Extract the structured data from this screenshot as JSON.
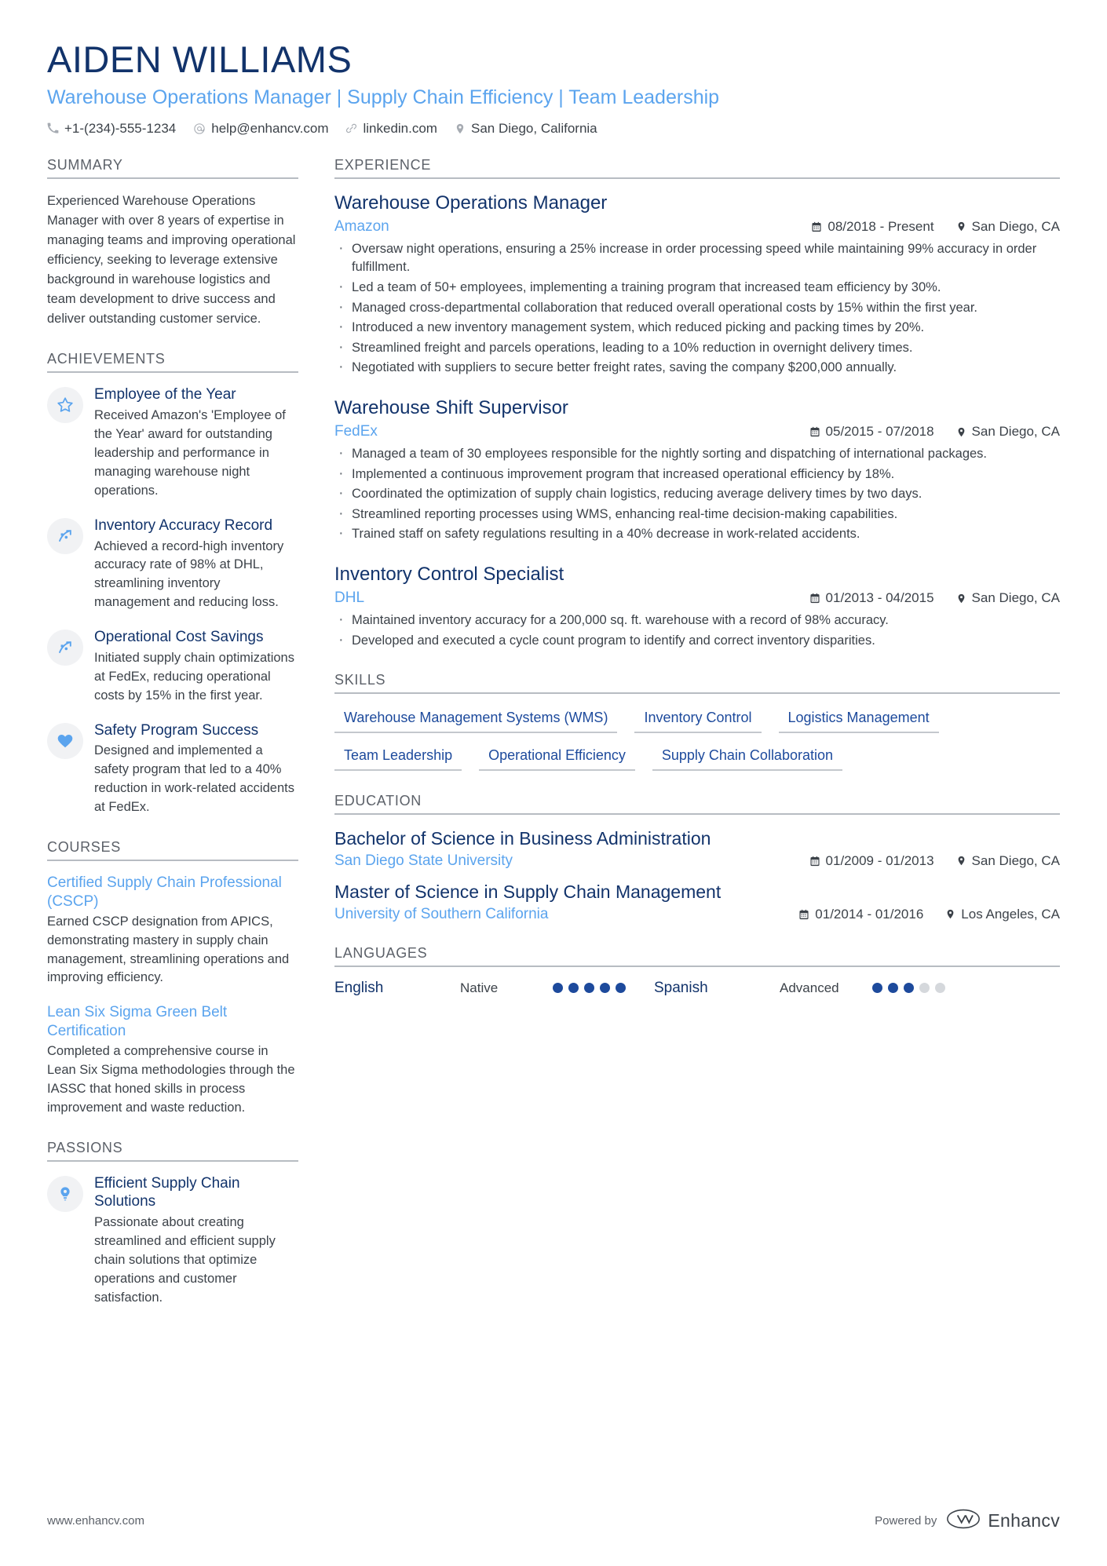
{
  "header": {
    "name": "AIDEN WILLIAMS",
    "headline": "Warehouse Operations Manager | Supply Chain Efficiency | Team Leadership",
    "contacts": [
      {
        "icon": "phone-icon",
        "text": "+1-(234)-555-1234"
      },
      {
        "icon": "email-icon",
        "text": "help@enhancv.com"
      },
      {
        "icon": "link-icon",
        "text": "linkedin.com"
      },
      {
        "icon": "location-icon",
        "text": "San Diego, California"
      }
    ]
  },
  "sections": {
    "summary_heading": "SUMMARY",
    "achievements_heading": "ACHIEVEMENTS",
    "courses_heading": "COURSES",
    "passions_heading": "PASSIONS",
    "experience_heading": "EXPERIENCE",
    "skills_heading": "SKILLS",
    "education_heading": "EDUCATION",
    "languages_heading": "LANGUAGES"
  },
  "summary": {
    "text": "Experienced Warehouse Operations Manager with over 8 years of expertise in managing teams and improving operational efficiency, seeking to leverage extensive background in warehouse logistics and team development to drive success and deliver outstanding customer service."
  },
  "achievements": [
    {
      "icon": "star-icon",
      "title": "Employee of the Year",
      "description": "Received Amazon's 'Employee of the Year' award for outstanding leadership and performance in managing warehouse night operations."
    },
    {
      "icon": "growth-arrow-icon",
      "title": "Inventory Accuracy Record",
      "description": "Achieved a record-high inventory accuracy rate of 98% at DHL, streamlining inventory management and reducing loss."
    },
    {
      "icon": "growth-arrow-icon",
      "title": "Operational Cost Savings",
      "description": "Initiated supply chain optimizations at FedEx, reducing operational costs by 15% in the first year."
    },
    {
      "icon": "heart-icon",
      "title": "Safety Program Success",
      "description": "Designed and implemented a safety program that led to a 40% reduction in work-related accidents at FedEx."
    }
  ],
  "courses": [
    {
      "title": "Certified Supply Chain Professional (CSCP)",
      "description": "Earned CSCP designation from APICS, demonstrating mastery in supply chain management, streamlining operations and improving efficiency."
    },
    {
      "title": "Lean Six Sigma Green Belt Certification",
      "description": "Completed a comprehensive course in Lean Six Sigma methodologies through the IASSC that honed skills in process improvement and waste reduction."
    }
  ],
  "passions": [
    {
      "icon": "lightbulb-icon",
      "title": "Efficient Supply Chain Solutions",
      "description": "Passionate about creating streamlined and efficient supply chain solutions that optimize operations and customer satisfaction."
    }
  ],
  "experience": [
    {
      "title": "Warehouse Operations Manager",
      "company": "Amazon",
      "dates": "08/2018 - Present",
      "location": "San Diego, CA",
      "bullets": [
        "Oversaw night operations, ensuring a 25% increase in order processing speed while maintaining 99% accuracy in order fulfillment.",
        "Led a team of 50+ employees, implementing a training program that increased team efficiency by 30%.",
        "Managed cross-departmental collaboration that reduced overall operational costs by 15% within the first year.",
        "Introduced a new inventory management system, which reduced picking and packing times by 20%.",
        "Streamlined freight and parcels operations, leading to a 10% reduction in overnight delivery times.",
        "Negotiated with suppliers to secure better freight rates, saving the company $200,000 annually."
      ]
    },
    {
      "title": "Warehouse Shift Supervisor",
      "company": "FedEx",
      "dates": "05/2015 - 07/2018",
      "location": "San Diego, CA",
      "bullets": [
        "Managed a team of 30 employees responsible for the nightly sorting and dispatching of international packages.",
        "Implemented a continuous improvement program that increased operational efficiency by 18%.",
        "Coordinated the optimization of supply chain logistics, reducing average delivery times by two days.",
        "Streamlined reporting processes using WMS, enhancing real-time decision-making capabilities.",
        "Trained staff on safety regulations resulting in a 40% decrease in work-related accidents."
      ]
    },
    {
      "title": "Inventory Control Specialist",
      "company": "DHL",
      "dates": "01/2013 - 04/2015",
      "location": "San Diego, CA",
      "bullets": [
        "Maintained inventory accuracy for a 200,000 sq. ft. warehouse with a record of 98% accuracy.",
        "Developed and executed a cycle count program to identify and correct inventory disparities."
      ]
    }
  ],
  "skills": [
    "Warehouse Management Systems (WMS)",
    "Inventory Control",
    "Logistics Management",
    "Team Leadership",
    "Operational Efficiency",
    "Supply Chain Collaboration"
  ],
  "education": [
    {
      "degree": "Bachelor of Science in Business Administration",
      "school": "San Diego State University",
      "dates": "01/2009 - 01/2013",
      "location": "San Diego, CA"
    },
    {
      "degree": "Master of Science in Supply Chain Management",
      "school": "University of Southern California",
      "dates": "01/2014 - 01/2016",
      "location": "Los Angeles, CA"
    }
  ],
  "languages": [
    {
      "name": "English",
      "level": "Native",
      "filled": 5,
      "total": 5
    },
    {
      "name": "Spanish",
      "level": "Advanced",
      "filled": 3,
      "total": 5
    }
  ],
  "footer": {
    "website": "www.enhancv.com",
    "powered_by": "Powered by",
    "brand": "Enhancv"
  },
  "colors": {
    "dark_blue": "#12336b",
    "light_blue": "#5ba4ee",
    "skill_blue": "#1d4a9c",
    "body_gray": "#3c4249",
    "heading_gray": "#5c6169",
    "rule_gray": "#b7bcc2"
  }
}
